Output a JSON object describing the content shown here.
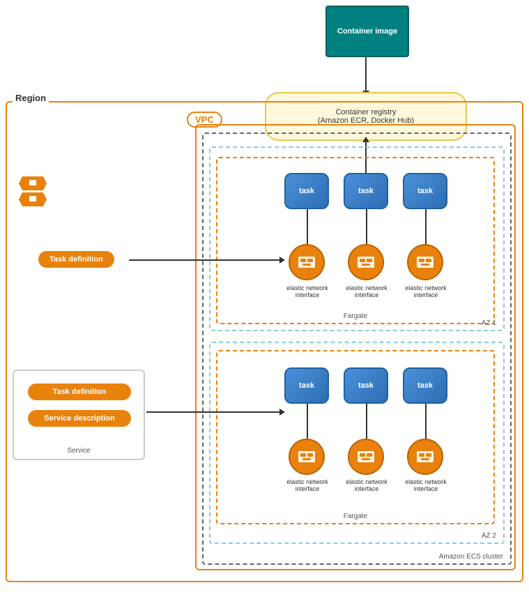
{
  "labels": {
    "region": "Region",
    "vpc": "VPC",
    "container_image": "Container image",
    "container_registry": "Container registry\n(Amazon ECR, Docker Hub)",
    "task": "task",
    "fargate": "Fargate",
    "eni": "elastic network\ninterface",
    "az1": "AZ 1",
    "az2": "AZ 2",
    "ecs_cluster": "Amazon ECS cluster",
    "task_definition": "Task definition",
    "service_description": "Service description",
    "service": "Service"
  },
  "colors": {
    "teal": "#008080",
    "orange": "#e8820c",
    "blue_task": "#4a90d9",
    "registry_bg": "#fff8dc",
    "registry_border": "#e8c84c"
  }
}
